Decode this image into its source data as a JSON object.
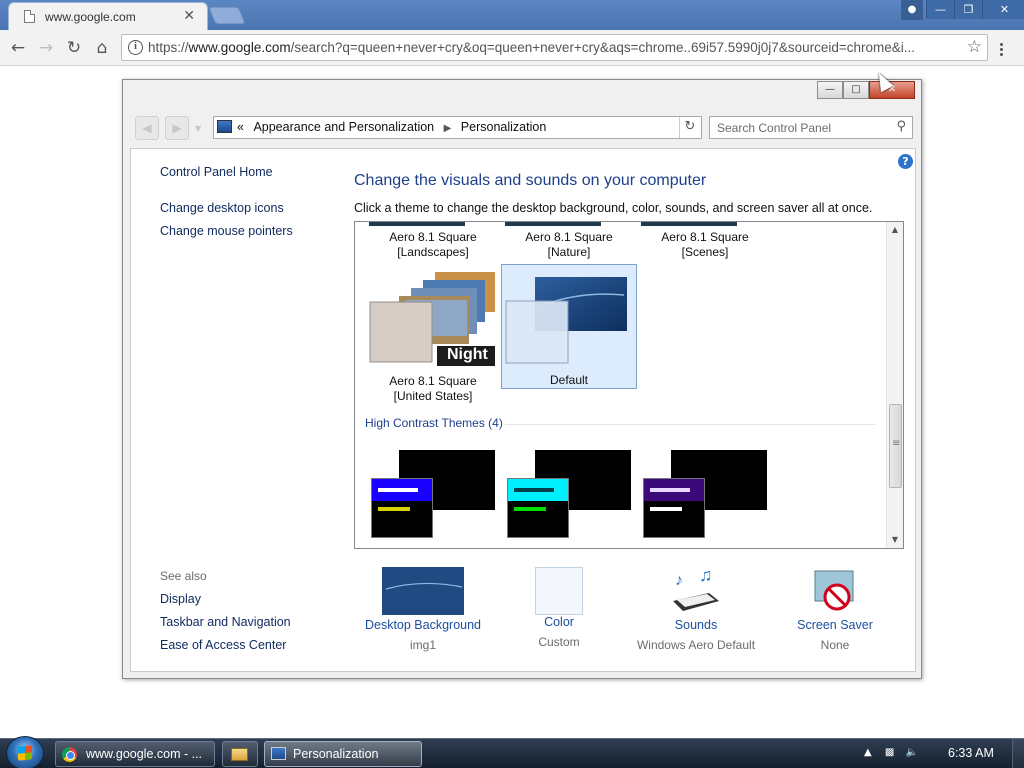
{
  "browser": {
    "tab_title": "www.google.com",
    "tab_close": "✕",
    "url_prefix": "https://",
    "url_host": "www.google.com",
    "url_rest": "/search?q=queen+never+cry&oq=queen+never+cry&aqs=chrome..69i57.5990j0j7&sourceid=chrome&i..."
  },
  "window": {
    "breadcrumb_prefix": "«",
    "breadcrumb_1": "Appearance and Personalization",
    "breadcrumb_2": "Personalization",
    "search_placeholder": "Search Control Panel"
  },
  "sidebar": {
    "home": "Control Panel Home",
    "link_desktop_icons": "Change desktop icons",
    "link_mouse_pointers": "Change mouse pointers",
    "see_also": "See also",
    "see_display": "Display",
    "see_taskbar": "Taskbar and Navigation",
    "see_ease": "Ease of Access Center"
  },
  "main": {
    "title": "Change the visuals and sounds on your computer",
    "description": "Click a theme to change the desktop background, color, sounds, and screen saver all at once."
  },
  "themes": {
    "top_row": [
      {
        "line1": "Aero 8.1 Square",
        "line2": "[Landscapes]"
      },
      {
        "line1": "Aero 8.1 Square",
        "line2": "[Nature]"
      },
      {
        "line1": "Aero 8.1 Square",
        "line2": "[Scenes]"
      }
    ],
    "united_states": {
      "line1": "Aero 8.1 Square",
      "line2": "[United States]",
      "badge": "Night"
    },
    "default": {
      "label": "Default"
    },
    "high_contrast_header": "High Contrast Themes (4)",
    "hc_colors": [
      {
        "bar": "#1a00ff",
        "line1": "#ffffff",
        "line2": "#d9d200"
      },
      {
        "bar": "#00f0ff",
        "line1": "#00404a",
        "line2": "#00e000"
      },
      {
        "bar": "#3c0a78",
        "line1": "#e8d8ff",
        "line2": "#ffffff"
      }
    ]
  },
  "bottom": {
    "desktop_background": {
      "name": "Desktop Background",
      "value": "img1"
    },
    "color": {
      "name": "Color",
      "value": "Custom"
    },
    "sounds": {
      "name": "Sounds",
      "value": "Windows Aero Default"
    },
    "screen_saver": {
      "name": "Screen Saver",
      "value": "None"
    }
  },
  "taskbar": {
    "chrome_item": "www.google.com - ...",
    "personalization_item": "Personalization",
    "clock": "6:33 AM"
  }
}
